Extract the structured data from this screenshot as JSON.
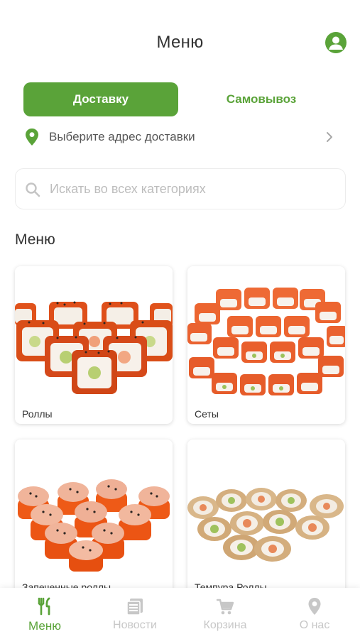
{
  "header": {
    "title": "Меню"
  },
  "delivery_toggle": {
    "active": "Доставку",
    "inactive": "Самовывоз"
  },
  "address": {
    "prompt": "Выберите адрес доставки"
  },
  "search": {
    "placeholder": "Искать во всех категориях",
    "value": ""
  },
  "menu_section": {
    "title": "Меню"
  },
  "categories": [
    {
      "label": "Роллы"
    },
    {
      "label": "Сеты"
    },
    {
      "label": "Запеченные роллы"
    },
    {
      "label": "Темпура Роллы"
    }
  ],
  "tabbar": {
    "items": [
      {
        "label": "Меню",
        "icon": "fork-knife-icon",
        "active": true
      },
      {
        "label": "Новости",
        "icon": "news-icon",
        "active": false
      },
      {
        "label": "Корзина",
        "icon": "cart-icon",
        "active": false
      },
      {
        "label": "О нас",
        "icon": "map-pin-icon",
        "active": false
      }
    ]
  },
  "colors": {
    "accent": "#5aa339",
    "inactive": "#c7c7c7",
    "text": "#333333"
  }
}
